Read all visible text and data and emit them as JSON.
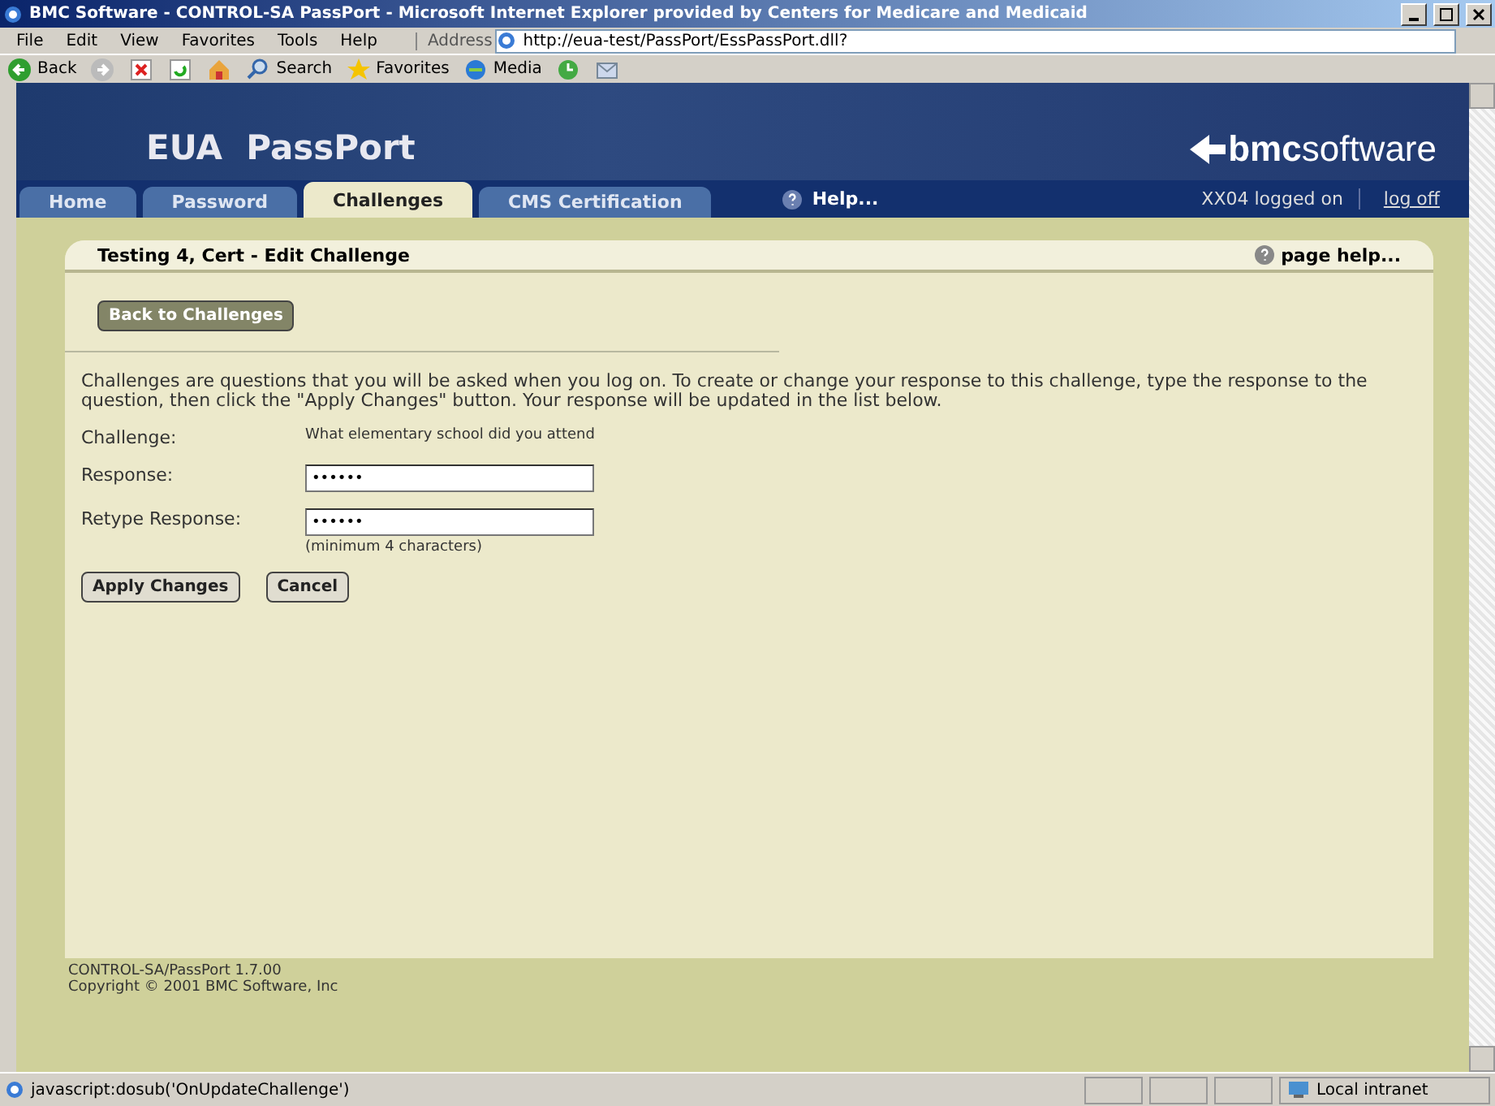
{
  "window": {
    "title": "BMC Software - CONTROL-SA PassPort - Microsoft Internet Explorer provided by Centers for Medicare and Medicaid"
  },
  "menu": [
    "File",
    "Edit",
    "View",
    "Favorites",
    "Tools",
    "Help"
  ],
  "address": {
    "label": "Address",
    "value": "http://eua-test/PassPort/EssPassPort.dll?"
  },
  "toolbar": [
    {
      "kind": "back",
      "label": "Back"
    },
    {
      "kind": "forward"
    },
    {
      "kind": "stop"
    },
    {
      "kind": "refresh"
    },
    {
      "kind": "home"
    },
    {
      "kind": "search",
      "label": "Search"
    },
    {
      "kind": "favorites",
      "label": "Favorites"
    },
    {
      "kind": "media",
      "label": "Media"
    },
    {
      "kind": "history"
    },
    {
      "kind": "mail"
    }
  ],
  "banner": {
    "title": "EUA  PassPort",
    "logo_bold": "bmc",
    "logo_light": "software"
  },
  "tabs": [
    {
      "label": "Home",
      "selected": false
    },
    {
      "label": "Password",
      "selected": false
    },
    {
      "label": "Challenges",
      "selected": true
    },
    {
      "label": "CMS Certification",
      "selected": false
    }
  ],
  "help_link": "Help...",
  "user_status": "XX04 logged on",
  "logoff": "log off",
  "panel": {
    "title": "Testing 4, Cert - Edit Challenge",
    "help": "page help...",
    "back_button": "Back to Challenges",
    "intro": "Challenges are questions that you will be asked when you log on. To create or change your response to this challenge, type the response to the question, then click the \"Apply Changes\" button. Your response will be updated in the list below.",
    "challenge_label": "Challenge:",
    "challenge": "What elementary school did you attend",
    "fields": [
      {
        "label": "Response:",
        "value": "••••••"
      },
      {
        "label": "Retype Response:",
        "value": "••••••",
        "hint": "(minimum 4 characters)"
      }
    ],
    "buttons": [
      "Apply Changes",
      "Cancel"
    ]
  },
  "footer": [
    "CONTROL-SA/PassPort 1.7.00",
    "Copyright © 2001 BMC Software, Inc"
  ],
  "status_bar": {
    "text": "javascript:dosub('OnUpdateChallenge')",
    "zone": "Local intranet"
  }
}
